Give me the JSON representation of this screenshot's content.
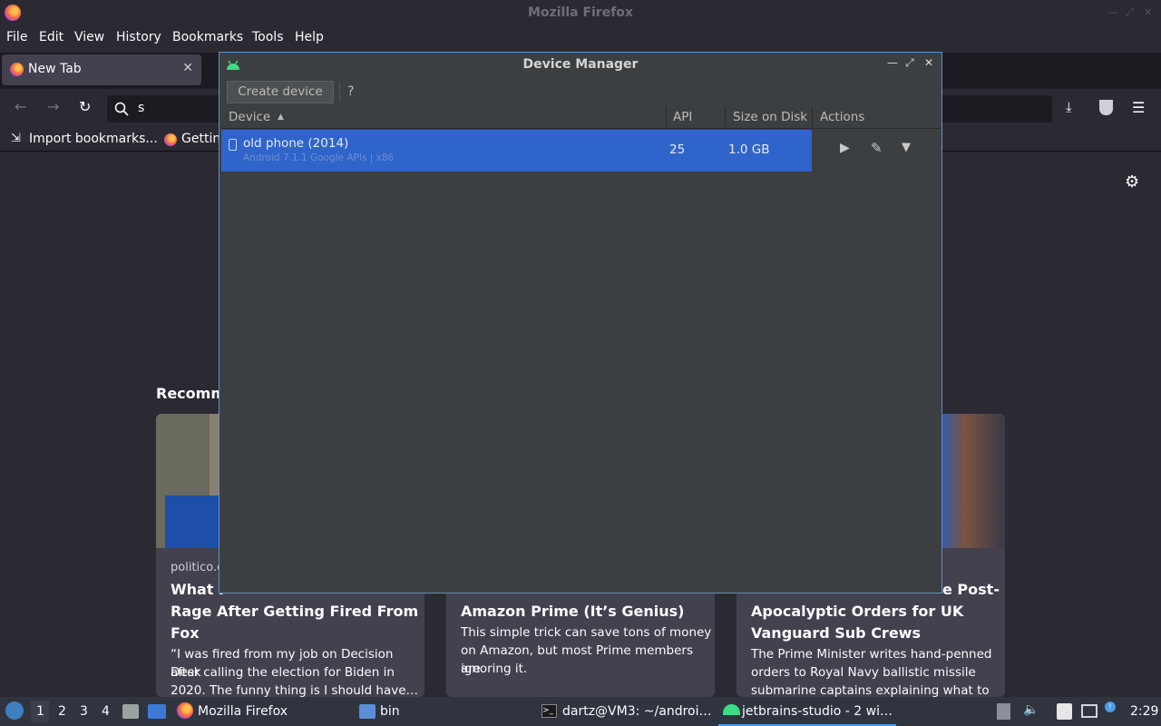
{
  "firefox": {
    "window_title": "Mozilla Firefox",
    "menu": [
      "File",
      "Edit",
      "View",
      "History",
      "Bookmarks",
      "Tools",
      "Help"
    ],
    "tab_label": "New Tab",
    "url_query": "s",
    "bookmarks": [
      "Import bookmarks...",
      "Gettin"
    ],
    "recommended_heading": "Recomm",
    "cards": [
      {
        "source": "politico.c",
        "title_lines": [
          "What I",
          "Rage After Getting Fired From",
          "Fox"
        ],
        "desc_lines": [
          "“I was fired from my job on Decision Desk",
          "after calling the election for Biden in",
          "2020. The funny thing is I should have…"
        ]
      },
      {
        "source": "",
        "title_lines": [
          "Amazon Prime (It’s Genius)"
        ],
        "desc_lines": [
          "This simple trick can save tons of money",
          "on Amazon, but most Prime members are",
          "ignoring it."
        ]
      },
      {
        "source": "",
        "title_lines": [
          "e Post-",
          "Apocalyptic Orders for UK",
          "Vanguard Sub Crews"
        ],
        "desc_lines": [
          "The Prime Minister writes hand-penned",
          "orders to Royal Navy ballistic missile",
          "submarine captains explaining what to …"
        ]
      }
    ]
  },
  "device_manager": {
    "title": "Device Manager",
    "create_button": "Create device",
    "help_button": "?",
    "columns": [
      "Device",
      "API",
      "Size on Disk",
      "Actions"
    ],
    "rows": [
      {
        "name": "old phone (2014)",
        "subtitle": "Android 7.1.1 Google APIs | x86",
        "api": "25",
        "size": "1.0 GB"
      }
    ]
  },
  "taskbar": {
    "workspaces": [
      "1",
      "2",
      "3",
      "4"
    ],
    "tasks": [
      "Mozilla Firefox",
      "bin",
      "dartz@VM3: ~/androi…",
      "jetbrains-studio - 2 wi…"
    ],
    "clock": "2:29"
  },
  "colors": {
    "selection": "#2f65ca",
    "dialog_bg": "#3c3f41",
    "firefox_bg": "#2b2a33"
  }
}
